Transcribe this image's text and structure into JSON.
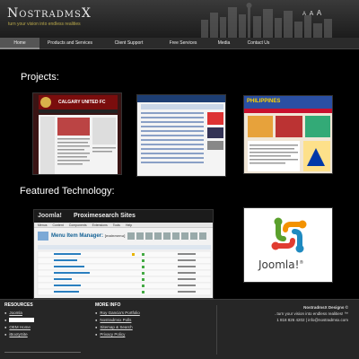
{
  "header": {
    "logo": "NostradmsX",
    "tagline": "turn your vision into endless realities",
    "text_size": [
      "A",
      "A",
      "A"
    ]
  },
  "nav": {
    "items": [
      {
        "label": "Home",
        "active": true
      },
      {
        "label": "Products and Services",
        "active": false
      },
      {
        "label": "Client Support",
        "active": false
      },
      {
        "label": "Free Services",
        "active": false
      },
      {
        "label": "Media",
        "active": false
      },
      {
        "label": "Contact Us",
        "active": false
      }
    ]
  },
  "projects": {
    "heading": "Projects:",
    "items": [
      {
        "title": "CALGARY UNITED FC"
      },
      {
        "title": "Proximesearch Sites"
      },
      {
        "title": "PHILIPPINES"
      }
    ]
  },
  "featured": {
    "heading": "Featured Technology:",
    "screenshot": {
      "brand": "Joomla!",
      "site": "Proximesearch Sites",
      "page_title": "Menu Item Manager:",
      "menu_name": "[mainmenu]",
      "menu": [
        "Menus",
        "Content",
        "Components",
        "Extensions",
        "Tools",
        "Help"
      ]
    },
    "logo_text": "Joomla!",
    "logo_sup": "®"
  },
  "footer": {
    "resources": {
      "heading": "RESOURCES",
      "links": [
        "Joomla",
        "",
        "OEM Home",
        "iBootySite"
      ]
    },
    "more_info": {
      "heading": "MORE INFO",
      "links": [
        "Roy Gancia's Portfolio",
        "Nostradmsx Polls",
        "Sitemap & Search",
        "Privacy Policy"
      ]
    },
    "copyright": {
      "line1": "NostradmsX Designs ©",
      "line2": "..turn your vision into endless realities! ™",
      "line3": "1 818 826 4202 | info@nostradmsx.com"
    }
  },
  "colors": {
    "background": "#000000",
    "header": "#2a2a2a",
    "tagline": "#b9a84a",
    "footer": "#262626",
    "joomla_green": "#5aa02c",
    "joomla_orange": "#f39200",
    "joomla_red": "#e03c31",
    "joomla_blue": "#1f8ac0"
  }
}
